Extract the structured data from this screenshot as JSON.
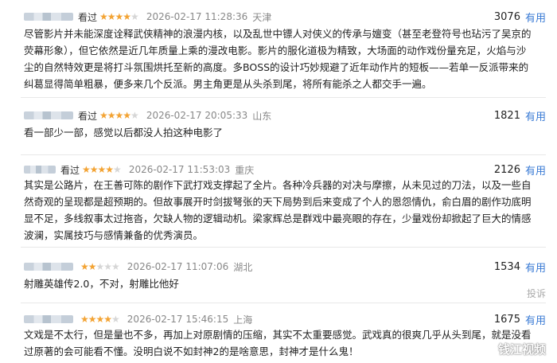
{
  "reviews": [
    {
      "prefix": "",
      "label": "看过",
      "rating": 4,
      "date": "2026-02-17 11:28:36",
      "location": "天津",
      "votes": "3076",
      "useful": "有用",
      "text": "尽管影片并未能深度诠释武侠精神的浪漫内核，以及乱世中镖人对侠义的传承与嬗变（甚至老登符号也玷污了吴京的荧幕形象），但它依然是近几年质量上乘的漫改电影。影片的服化道极为精致，大场面的动作戏份量充足，火焰与沙尘的自然特效更是将打斗氛围烘托至新的高度。多BOSS的设计巧妙规避了近年动作片的短板——若单一反派带来的纠葛显得简单粗暴，便多来几个反派。男主角更是从头杀到尾，将所有能杀之人都交手一遍。"
    },
    {
      "prefix": "",
      "label": "看过",
      "rating": 4,
      "date": "2026-02-17 20:05:33",
      "location": "山东",
      "votes": "1821",
      "useful": "有用",
      "text": "看一部少一部，感觉以后都没人拍这种电影了"
    },
    {
      "prefix": "",
      "label": "看过",
      "rating": 4,
      "date": "2026-02-17 11:53:03",
      "location": "重庆",
      "votes": "2126",
      "useful": "有用",
      "text": "其实是公路片，在王善可陈的剧作下武打戏支撑起了全片。各种冷兵器的对决与摩擦，从未见过的刀法，以及一些自然奇观的呈现都是超预期的。但故事展开时剑拔弩张的天下局势到后来变成了个人的恩怨情仇，俞白眉的剧作功底明显不足，多线叙事太过拖沓，欠缺人物的逻辑动机。梁家辉总是群戏中最亮眼的存在，少量戏份却掀起了巨大的情感波澜，实属技巧与感情兼备的优秀演员。"
    },
    {
      "prefix": "",
      "label": "",
      "rating": 2,
      "date": "2026-02-17 11:07:06",
      "location": "湖北",
      "votes": "1534",
      "useful": "有用",
      "text": "射雕英雄传2.0，不对，射雕比他好",
      "report": "投诉"
    },
    {
      "prefix": "",
      "label": "",
      "rating": 4,
      "date": "2026-02-17 15:46:15",
      "location": "上海",
      "votes": "1675",
      "useful": "有用",
      "text": "文戏是不太行，但是量也不多，再加上对原剧情的压缩，其实不太重要感觉。武戏真的很爽几乎从头到尾，就是没看过原著的会可能看不懂。没明白说不如封神2的是啥意思，封神才是什么鬼！"
    }
  ],
  "watermark": {
    "text": "钱江视频",
    "icon": "weibo-icon"
  },
  "colors": {
    "star": "#f3a333",
    "link": "#3a7bd5"
  }
}
